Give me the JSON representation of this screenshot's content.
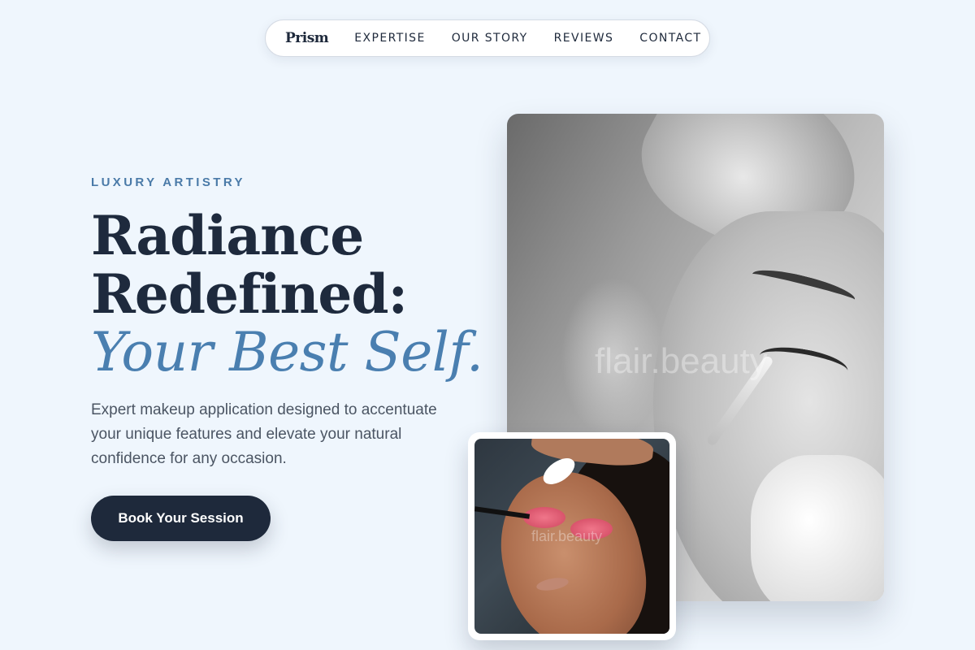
{
  "nav": {
    "brand": "Prism",
    "links": [
      {
        "label": "EXPERTISE"
      },
      {
        "label": "OUR STORY"
      },
      {
        "label": "REVIEWS"
      },
      {
        "label": "CONTACT"
      }
    ]
  },
  "hero": {
    "eyebrow": "LUXURY ARTISTRY",
    "title_line1": "Radiance",
    "title_line2": "Redefined:",
    "title_accent": "Your Best Self.",
    "description": "Expert makeup application designed to accentuate your unique features and elevate your natural confidence for any occasion.",
    "cta_label": "Book Your Session"
  },
  "images": {
    "main_watermark": "flair.beauty",
    "inset_watermark": "flair.beauty"
  },
  "colors": {
    "background": "#eff6fd",
    "primary_dark": "#1e293b",
    "accent_blue": "#4a7fb0",
    "eyebrow_blue": "#4a7aa8"
  }
}
